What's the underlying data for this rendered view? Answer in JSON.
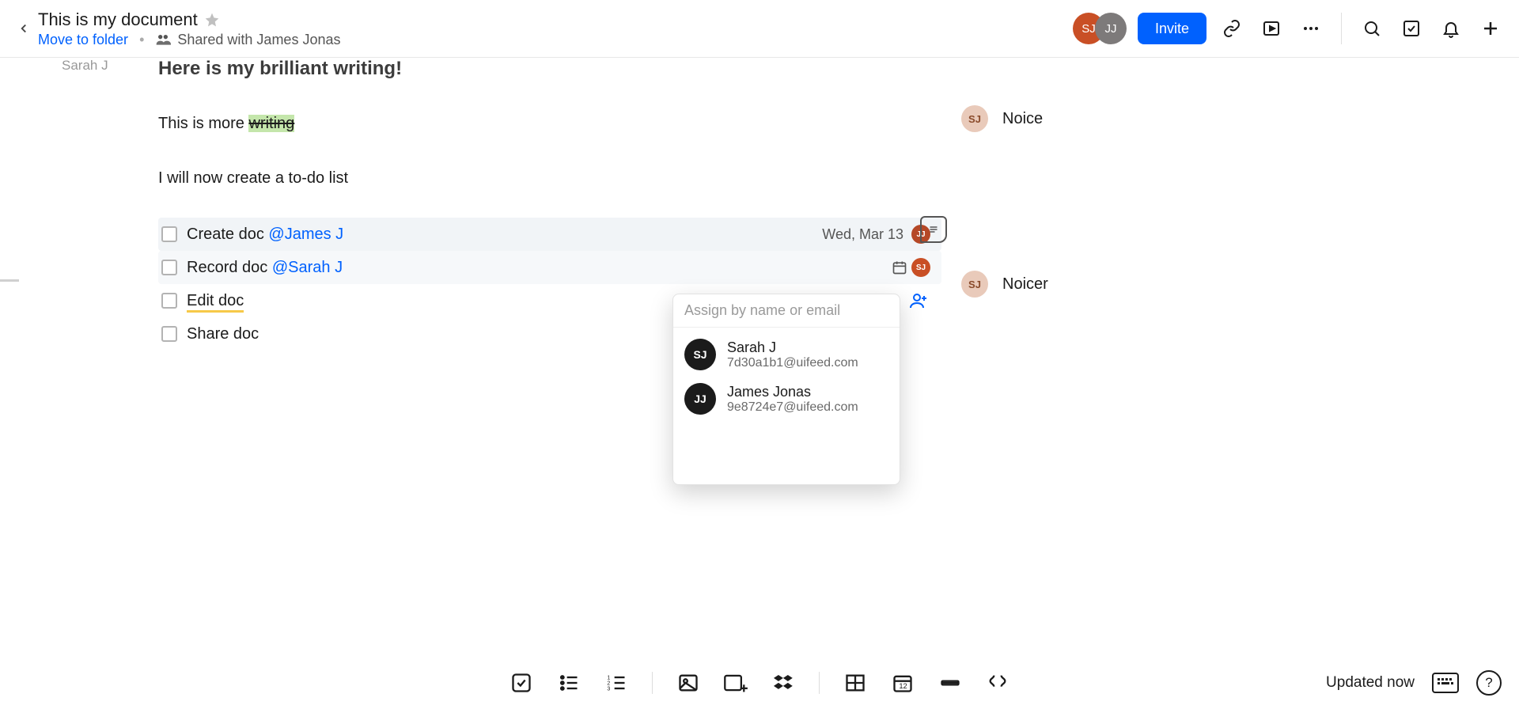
{
  "header": {
    "title": "This is my document",
    "move_link": "Move to folder",
    "shared_with": "Shared with James Jonas",
    "avatars": [
      {
        "initials": "SJ",
        "cls": "av-sj"
      },
      {
        "initials": "JJ",
        "cls": "av-jj"
      }
    ],
    "invite_label": "Invite"
  },
  "left_rail": {
    "name": "Sarah J"
  },
  "content": {
    "heading": "Here is my brilliant writing!",
    "p1_pre": "This is more ",
    "p1_hl": "writing",
    "p2": "I will now create a to-do list"
  },
  "todos": [
    {
      "text": "Create doc",
      "mention": "@James J",
      "due": "Wed, Mar 13",
      "av_initials": "JJ",
      "av_cls": "jj",
      "active": true
    },
    {
      "text": "Record doc",
      "mention": "@Sarah J",
      "show_cal": true,
      "av_initials": "SJ",
      "av_cls": "sj",
      "active": true
    },
    {
      "text": "Edit doc",
      "underline": true,
      "show_cal": true,
      "show_add_person": true
    },
    {
      "text": "Share doc"
    }
  ],
  "comments": [
    {
      "av": "SJ",
      "text": "Noice"
    },
    {
      "av": "SJ",
      "text": "Noicer"
    }
  ],
  "assign_popover": {
    "placeholder": "Assign by name or email",
    "items": [
      {
        "initials": "SJ",
        "name": "Sarah J",
        "email": "7d30a1b1@uifeed.com"
      },
      {
        "initials": "JJ",
        "name": "James Jonas",
        "email": "9e8724e7@uifeed.com"
      }
    ]
  },
  "footer": {
    "updated": "Updated now"
  }
}
